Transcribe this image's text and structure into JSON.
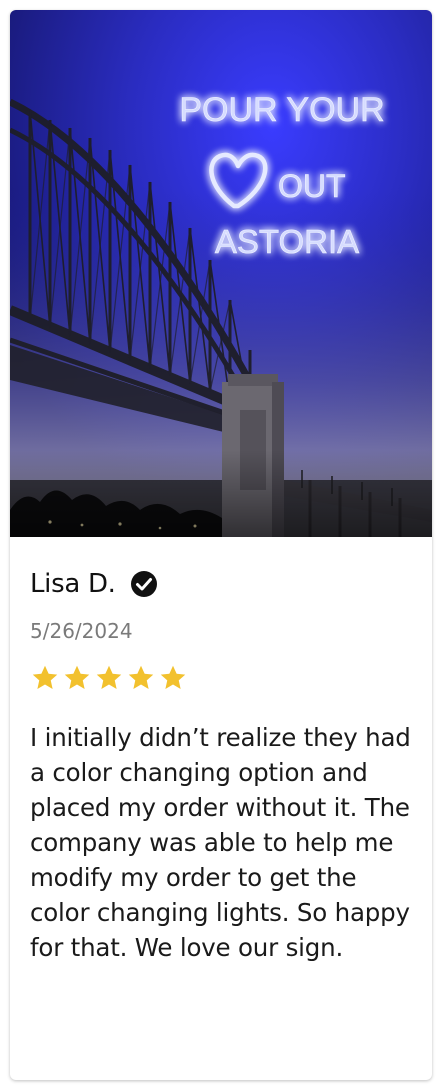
{
  "review": {
    "reviewer_name": "Lisa D.",
    "verified_icon": "verified-check-icon",
    "date": "5/26/2024",
    "rating": 5,
    "rating_max": 5,
    "star_color": "#f2c12e",
    "text": "I initially didn’t realize they had a color changing option and placed my order without it. The company was able to help me modify my order to get the color changing lights. So happy for that. We love our sign."
  },
  "photo": {
    "sign_line_1": "POUR YOUR",
    "sign_line_2": "OUT",
    "sign_line_3": "ASTORIA",
    "sign_icon": "heart-icon",
    "neon_color": "#c9d4ff",
    "wall_color": "#2b2fd0"
  }
}
